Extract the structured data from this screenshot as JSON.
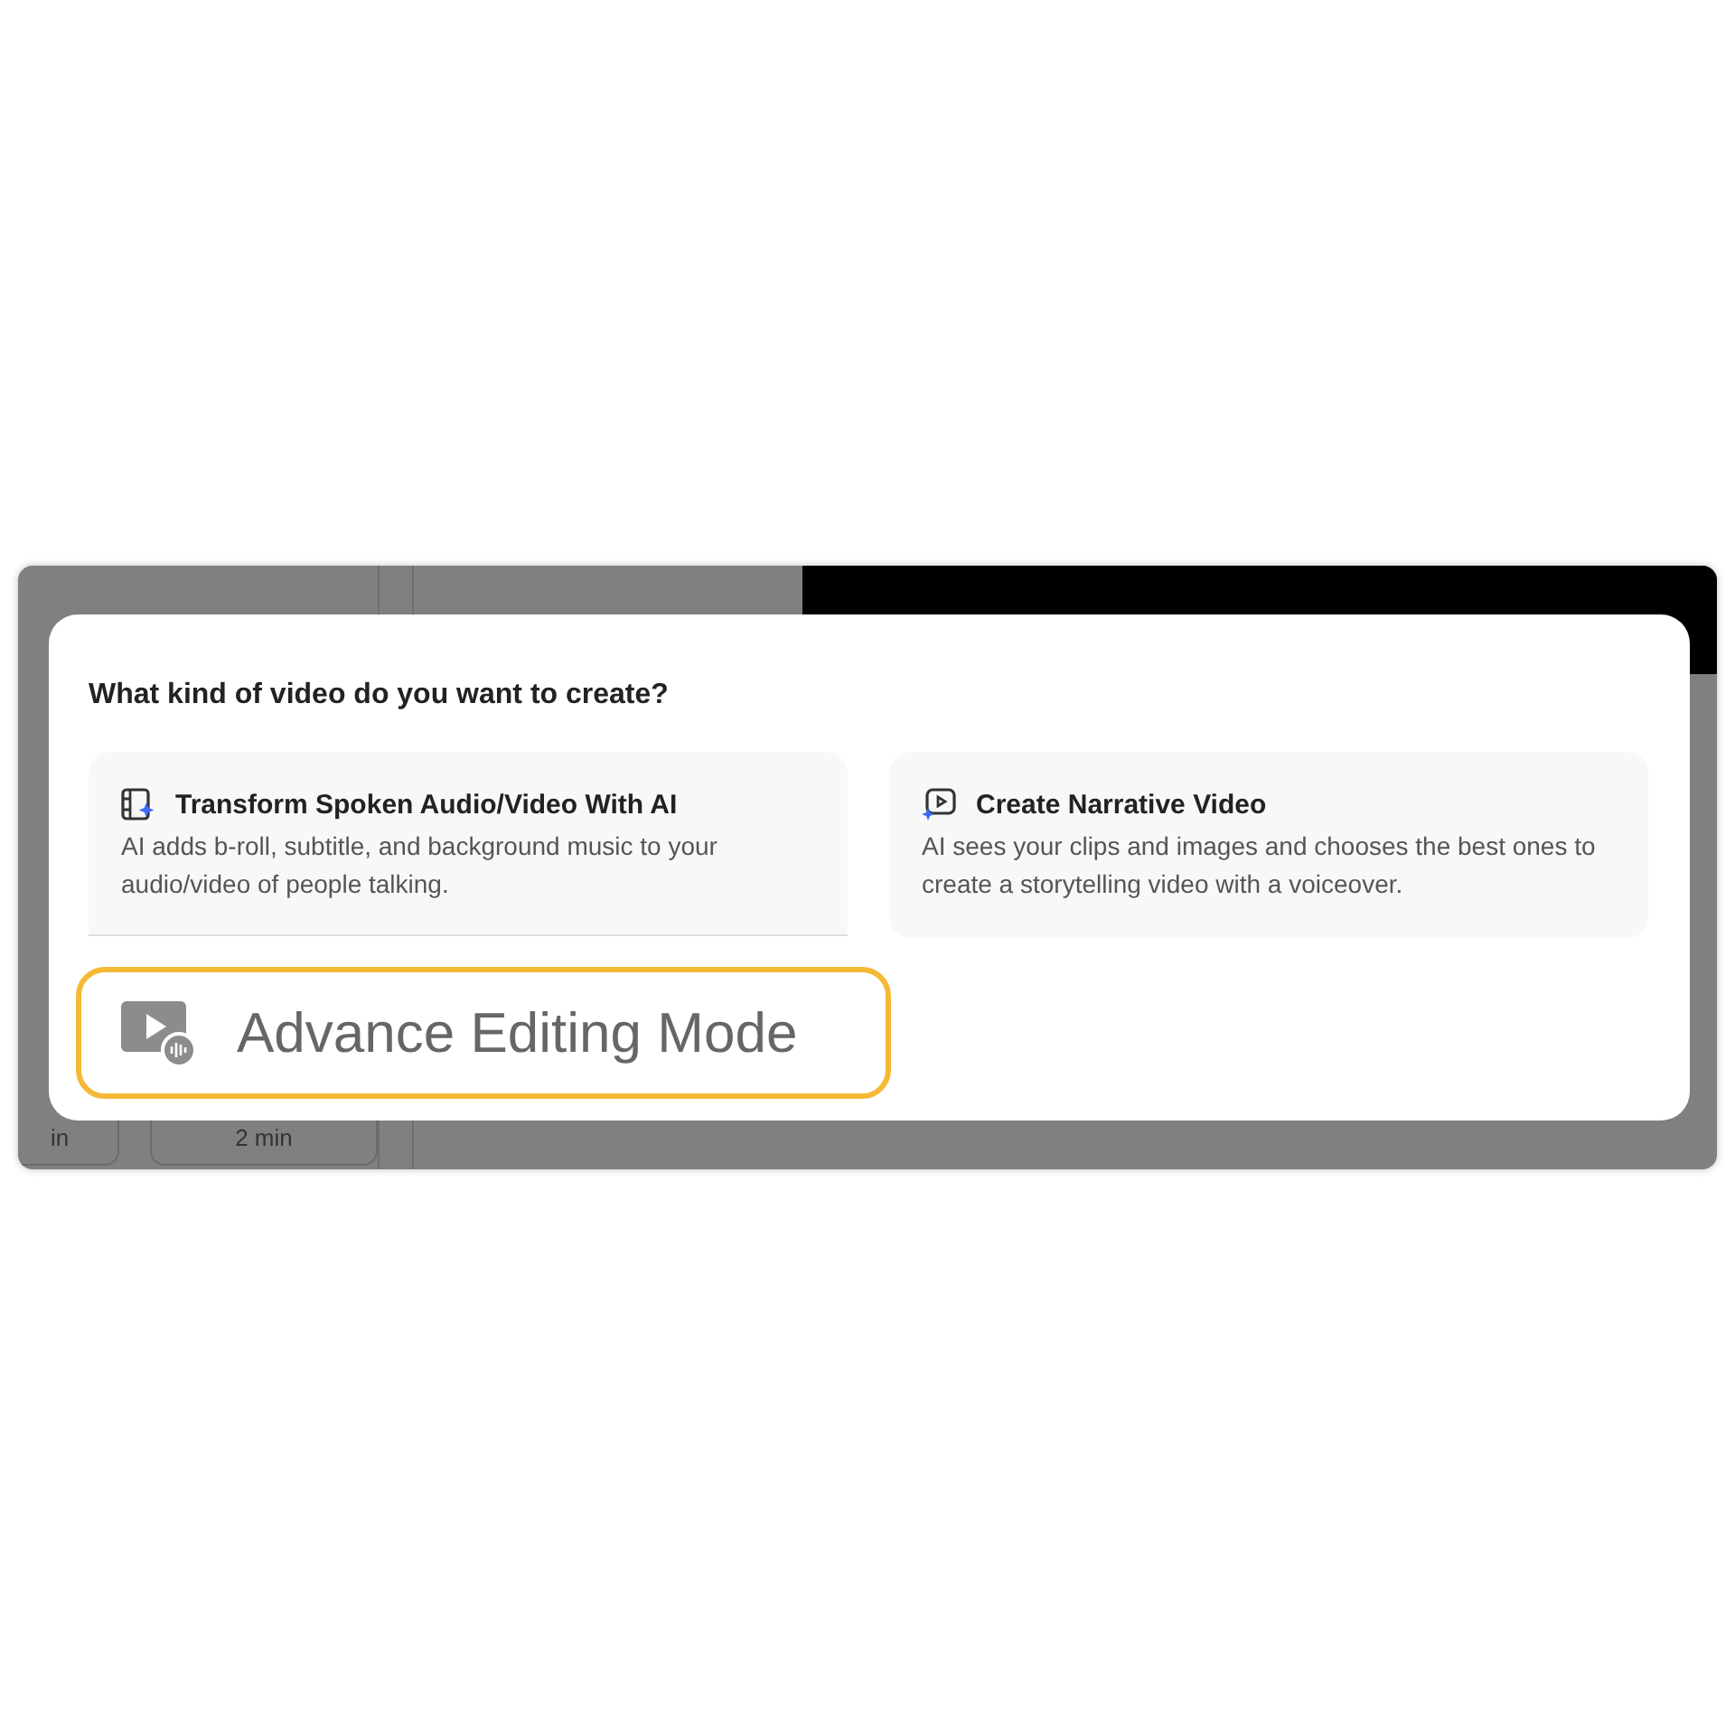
{
  "background_chips": [
    "in",
    "2 min"
  ],
  "dialog": {
    "question": "What kind of video do you want to create?",
    "options": [
      {
        "kind": "transform",
        "title": "Transform Spoken Audio/Video With AI",
        "description": "AI adds b-roll, subtitle, and background music to your audio/video of people talking."
      },
      {
        "kind": "narrative",
        "title": "Create Narrative Video",
        "description": "AI sees your clips and images and chooses the best ones to create a storytelling video with a voiceover."
      }
    ],
    "highlight": {
      "label": "Advance Editing Mode"
    }
  }
}
